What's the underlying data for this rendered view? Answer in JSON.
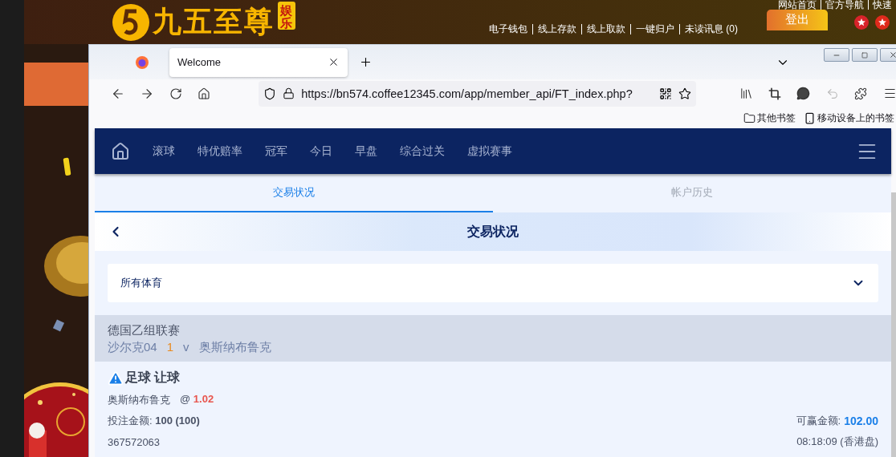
{
  "site": {
    "logo_text": "九五至尊",
    "logo_badge": "娱乐",
    "top_links": [
      "网站首页",
      "官方导航",
      "快速"
    ],
    "account_links": [
      "电子钱包",
      "线上存款",
      "线上取款",
      "一键归户",
      "未读讯息 (0)"
    ],
    "logout": "登出"
  },
  "browser": {
    "tabs": [
      {
        "title": "Welcome",
        "selected": true
      }
    ],
    "url": "https://bn574.coffee12345.com/app/member_api/FT_index.php?",
    "undo": {
      "disabled": true
    },
    "bookmarks": [
      {
        "kind": "folder",
        "label": "其他书签"
      },
      {
        "kind": "device",
        "label": "移动设备上的书签"
      }
    ]
  },
  "nav": {
    "items": [
      "滚球",
      "特优赔率",
      "冠军",
      "今日",
      "早盘",
      "综合过关",
      "虚拟赛事"
    ]
  },
  "page_tabs": [
    {
      "label": "交易状况",
      "selected": true
    },
    {
      "label": "帐户历史",
      "selected": false
    }
  ],
  "header": {
    "title": "交易状况"
  },
  "filter": {
    "value": "所有体育"
  },
  "league": {
    "name": "德国乙组联赛",
    "home": "沙尔克04",
    "score": "1",
    "vs": "v",
    "away": "奥斯纳布鲁克"
  },
  "bet": {
    "title": "足球 让球",
    "selection": "奥斯纳布鲁克",
    "at": "@",
    "odds": "1.02",
    "stake": "投注金额: **100 (100)**",
    "win_label": "可赢金额:",
    "win": "102.00",
    "ticket": "367572063",
    "time": "08:18:09 (香港盘)"
  }
}
